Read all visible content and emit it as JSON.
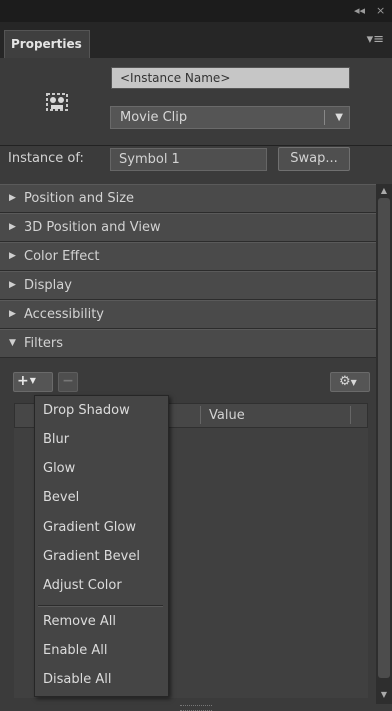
{
  "window": {
    "collapse_glyph": "◂◂",
    "close_glyph": "×"
  },
  "tab": {
    "label": "Properties",
    "menu_glyph": "▾≡"
  },
  "instance": {
    "name_placeholder": "<Instance Name>",
    "type_value": "Movie Clip",
    "instance_of_label": "Instance of:",
    "symbol_value": "Symbol 1",
    "swap_label": "Swap..."
  },
  "sections": [
    {
      "label": "Position and Size",
      "expanded": false
    },
    {
      "label": "3D Position and View",
      "expanded": false
    },
    {
      "label": "Color Effect",
      "expanded": false
    },
    {
      "label": "Display",
      "expanded": false
    },
    {
      "label": "Accessibility",
      "expanded": false
    },
    {
      "label": "Filters",
      "expanded": true
    }
  ],
  "filters_toolbar": {
    "add_glyph": "+",
    "delete_glyph": "−",
    "options_glyph": "⚙"
  },
  "filters_list": {
    "value_header": "Value"
  },
  "add_filter_menu": {
    "items": [
      "Drop Shadow",
      "Blur",
      "Glow",
      "Bevel",
      "Gradient Glow",
      "Gradient Bevel",
      "Adjust Color"
    ],
    "actions": [
      "Remove All",
      "Enable All",
      "Disable All"
    ]
  },
  "icons": {
    "symbol": "movie-clip-icon",
    "collapse": "double-chevron-left-icon",
    "close": "close-icon",
    "panel_menu": "panel-menu-icon",
    "dropdown": "dropdown-arrow-icon",
    "add": "plus-icon",
    "delete": "minus-icon",
    "options": "gear-icon"
  },
  "colors": {
    "panel_bg": "#3b3b3b",
    "section_bg": "#4a4a4a",
    "text": "#d3d3d3",
    "input_bg": "#c6c6c6",
    "menu_bg": "#454545"
  }
}
